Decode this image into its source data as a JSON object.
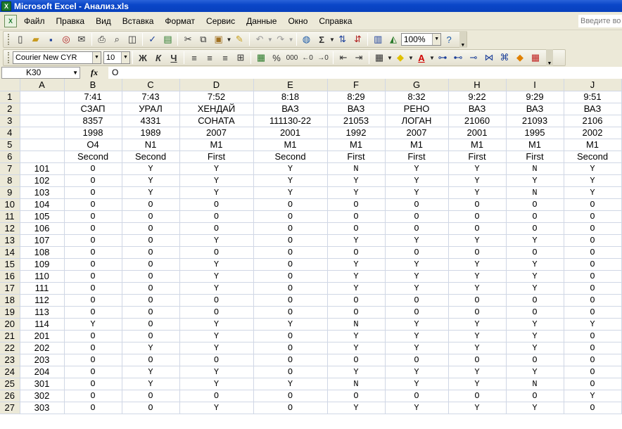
{
  "window": {
    "title": "Microsoft Excel - Анализ.xls",
    "app_icon_letter": "X"
  },
  "menu": {
    "items": [
      "Файл",
      "Правка",
      "Вид",
      "Вставка",
      "Формат",
      "Сервис",
      "Данные",
      "Окно",
      "Справка"
    ],
    "help_placeholder": "Введите вопрос"
  },
  "toolbar": {
    "zoom": "100%"
  },
  "format_toolbar": {
    "font_name": "Courier New CYR",
    "font_size": "10",
    "bold": "Ж",
    "italic": "К",
    "underline": "Ч",
    "percent": "%",
    "thousands": "000"
  },
  "formula_bar": {
    "cell_ref": "K30",
    "fx": "fx",
    "content": "O"
  },
  "sheet": {
    "columns": [
      "A",
      "B",
      "C",
      "D",
      "E",
      "F",
      "G",
      "H",
      "I",
      "J"
    ],
    "header_rows": [
      [
        "",
        "7:41",
        "7:43",
        "7:52",
        "8:18",
        "8:29",
        "8:32",
        "9:22",
        "9:29",
        "9:51"
      ],
      [
        "",
        "СЗАП",
        "УРАЛ",
        "ХЕНДАЙ",
        "ВАЗ",
        "ВАЗ",
        "РЕНО",
        "ВАЗ",
        "ВАЗ",
        "ВАЗ"
      ],
      [
        "",
        "8357",
        "4331",
        "СОНАТА",
        "111130-22",
        "21053",
        "ЛОГАН",
        "21060",
        "21093",
        "2106"
      ],
      [
        "",
        "1998",
        "1989",
        "2007",
        "2001",
        "1992",
        "2007",
        "2001",
        "1995",
        "2002"
      ],
      [
        "",
        "O4",
        "N1",
        "M1",
        "M1",
        "M1",
        "M1",
        "M1",
        "M1",
        "M1"
      ],
      [
        "",
        "Second",
        "Second",
        "First",
        "Second",
        "First",
        "First",
        "First",
        "First",
        "Second"
      ]
    ],
    "data_rows": [
      [
        "101",
        "O",
        "Y",
        "Y",
        "Y",
        "N",
        "Y",
        "Y",
        "N",
        "Y"
      ],
      [
        "102",
        "O",
        "Y",
        "Y",
        "Y",
        "Y",
        "Y",
        "Y",
        "Y",
        "Y"
      ],
      [
        "103",
        "O",
        "Y",
        "Y",
        "Y",
        "Y",
        "Y",
        "Y",
        "N",
        "Y"
      ],
      [
        "104",
        "O",
        "O",
        "O",
        "O",
        "O",
        "O",
        "O",
        "O",
        "O"
      ],
      [
        "105",
        "O",
        "O",
        "O",
        "O",
        "O",
        "O",
        "O",
        "O",
        "O"
      ],
      [
        "106",
        "O",
        "O",
        "O",
        "O",
        "O",
        "O",
        "O",
        "O",
        "O"
      ],
      [
        "107",
        "O",
        "O",
        "Y",
        "O",
        "Y",
        "Y",
        "Y",
        "Y",
        "O"
      ],
      [
        "108",
        "O",
        "O",
        "O",
        "O",
        "O",
        "O",
        "O",
        "O",
        "O"
      ],
      [
        "109",
        "O",
        "O",
        "Y",
        "O",
        "Y",
        "Y",
        "Y",
        "Y",
        "O"
      ],
      [
        "110",
        "O",
        "O",
        "Y",
        "O",
        "Y",
        "Y",
        "Y",
        "Y",
        "O"
      ],
      [
        "111",
        "O",
        "O",
        "Y",
        "O",
        "Y",
        "Y",
        "Y",
        "Y",
        "O"
      ],
      [
        "112",
        "O",
        "O",
        "O",
        "O",
        "O",
        "O",
        "O",
        "O",
        "O"
      ],
      [
        "113",
        "O",
        "O",
        "O",
        "O",
        "O",
        "O",
        "O",
        "O",
        "O"
      ],
      [
        "114",
        "Y",
        "O",
        "Y",
        "Y",
        "N",
        "Y",
        "Y",
        "Y",
        "Y"
      ],
      [
        "201",
        "O",
        "O",
        "Y",
        "O",
        "Y",
        "Y",
        "Y",
        "Y",
        "O"
      ],
      [
        "202",
        "O",
        "Y",
        "Y",
        "O",
        "Y",
        "Y",
        "Y",
        "Y",
        "O"
      ],
      [
        "203",
        "O",
        "O",
        "O",
        "O",
        "O",
        "O",
        "O",
        "O",
        "O"
      ],
      [
        "204",
        "O",
        "Y",
        "Y",
        "O",
        "Y",
        "Y",
        "Y",
        "Y",
        "O"
      ],
      [
        "301",
        "O",
        "Y",
        "Y",
        "Y",
        "N",
        "Y",
        "Y",
        "N",
        "O"
      ],
      [
        "302",
        "O",
        "O",
        "O",
        "O",
        "O",
        "O",
        "O",
        "O",
        "Y"
      ],
      [
        "303",
        "O",
        "O",
        "Y",
        "O",
        "Y",
        "Y",
        "Y",
        "Y",
        "O"
      ]
    ]
  }
}
